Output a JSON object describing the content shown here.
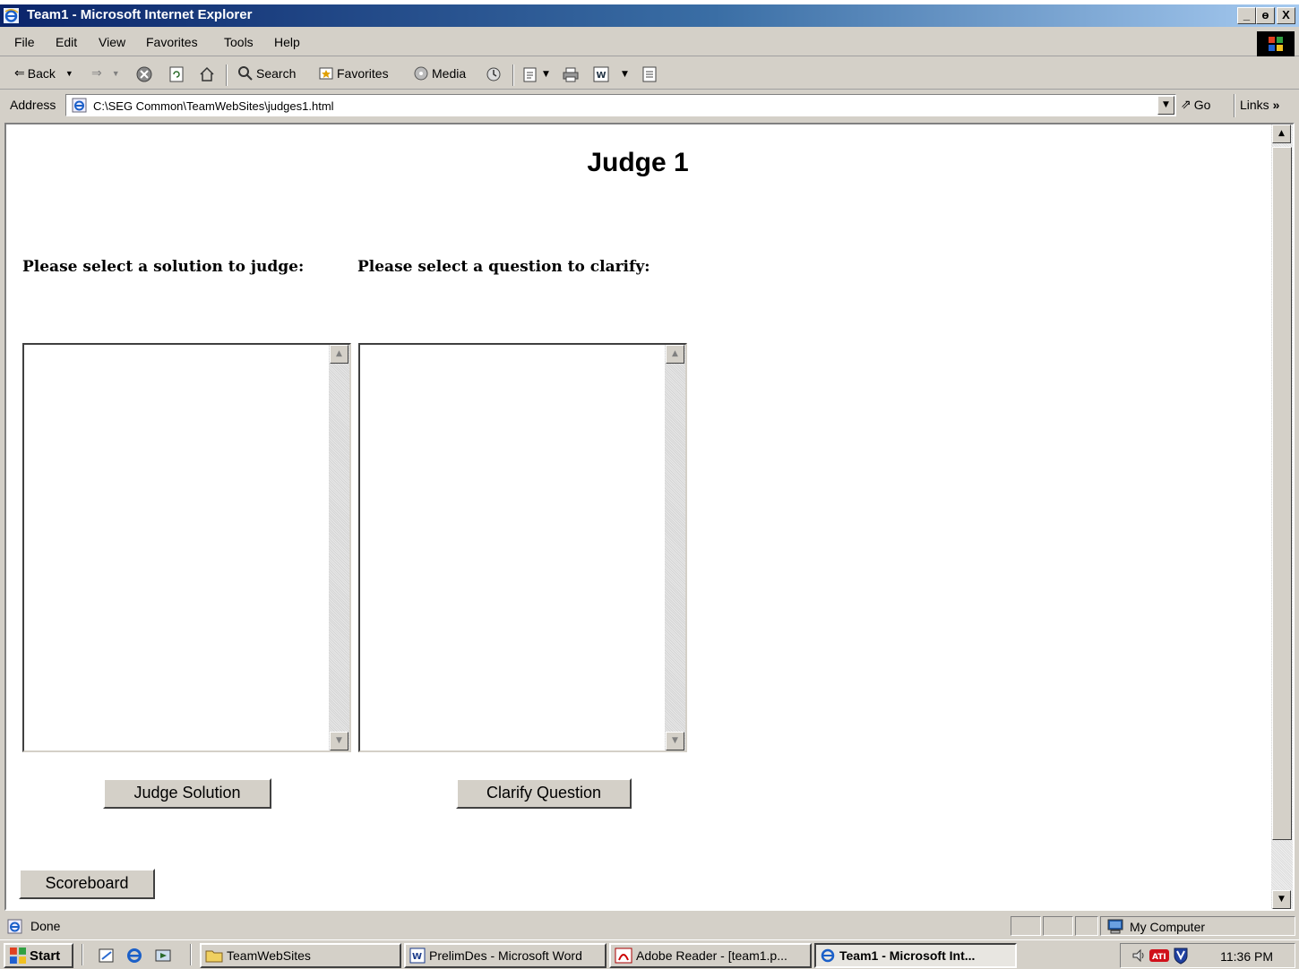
{
  "window": {
    "title": "Team1 - Microsoft Internet Explorer",
    "buttons": {
      "minimize": "_",
      "maximize": "ɵ",
      "close": "X"
    }
  },
  "menu": [
    "File",
    "Edit",
    "View",
    "Favorites",
    "Tools",
    "Help"
  ],
  "toolbar": {
    "back": "Back",
    "search": "Search",
    "favorites": "Favorites",
    "media": "Media"
  },
  "address": {
    "label": "Address",
    "url": "C:\\SEG Common\\TeamWebSites\\judges1.html",
    "go": "Go",
    "links": "Links"
  },
  "page": {
    "title": "Judge 1",
    "solution_prompt": "Please select a solution to judge:",
    "question_prompt": "Please select a question to clarify:",
    "solutions": [],
    "questions": [],
    "judge_button": "Judge Solution",
    "clarify_button": "Clarify Question",
    "scoreboard_button": "Scoreboard"
  },
  "status": {
    "text": "Done",
    "zone": "My Computer"
  },
  "taskbar": {
    "start": "Start",
    "tasks": [
      {
        "label": "TeamWebSites",
        "icon": "folder-icon"
      },
      {
        "label": "PrelimDes - Microsoft Word",
        "icon": "word-icon"
      },
      {
        "label": "Adobe Reader - [team1.p...",
        "icon": "adobe-reader-icon"
      },
      {
        "label": "Team1 - Microsoft Int...",
        "icon": "ie-icon"
      }
    ],
    "clock": "11:36 PM"
  },
  "colors": {
    "titlebar_start": "#0a246a",
    "titlebar_end": "#a6caf0",
    "chrome": "#d4d0c8"
  }
}
